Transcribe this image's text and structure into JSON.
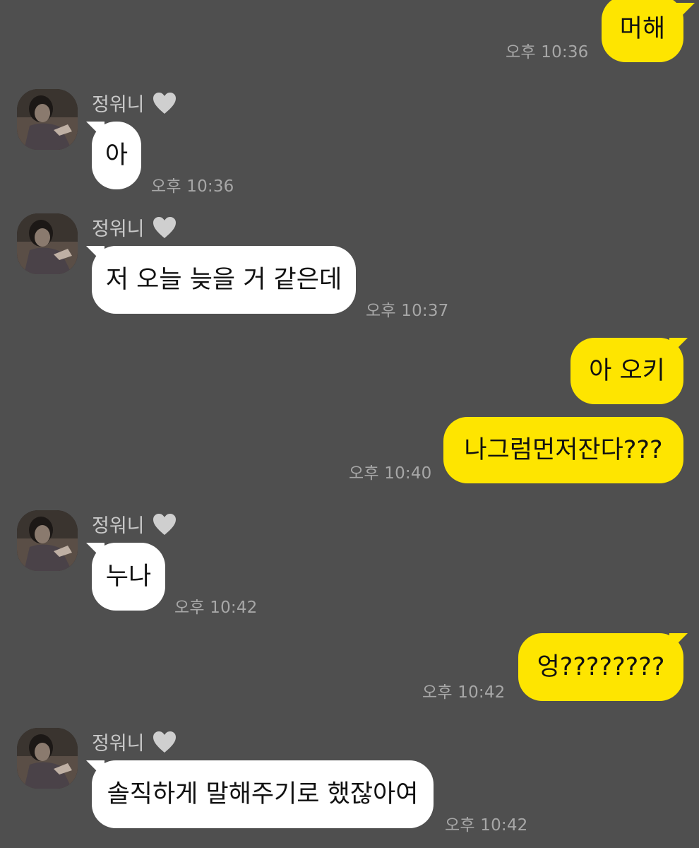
{
  "contact": {
    "name": "정워니",
    "badge_icon": "heart-icon",
    "badge_color": "#cfcfcf"
  },
  "colors": {
    "background": "#4f4f4f",
    "outgoing_bubble": "#fee500",
    "incoming_bubble": "#ffffff",
    "timestamp": "#a7a7a7"
  },
  "messages": [
    {
      "direction": "outgoing",
      "text": "머해",
      "time": "오후 10:36"
    },
    {
      "direction": "incoming",
      "sender": "정워니",
      "text": "아",
      "time": "오후 10:36"
    },
    {
      "direction": "incoming",
      "sender": "정워니",
      "text": "저 오늘 늦을 거 같은데",
      "time": "오후 10:37"
    },
    {
      "direction": "outgoing",
      "text": "아 오키",
      "time": ""
    },
    {
      "direction": "outgoing",
      "text": "나그럼먼저잔다???",
      "time": "오후 10:40"
    },
    {
      "direction": "incoming",
      "sender": "정워니",
      "text": "누나",
      "time": "오후 10:42"
    },
    {
      "direction": "outgoing",
      "text": "엉????????",
      "time": "오후 10:42"
    },
    {
      "direction": "incoming",
      "sender": "정워니",
      "text": "솔직하게 말해주기로 했잖아여",
      "time": "오후 10:42"
    }
  ]
}
